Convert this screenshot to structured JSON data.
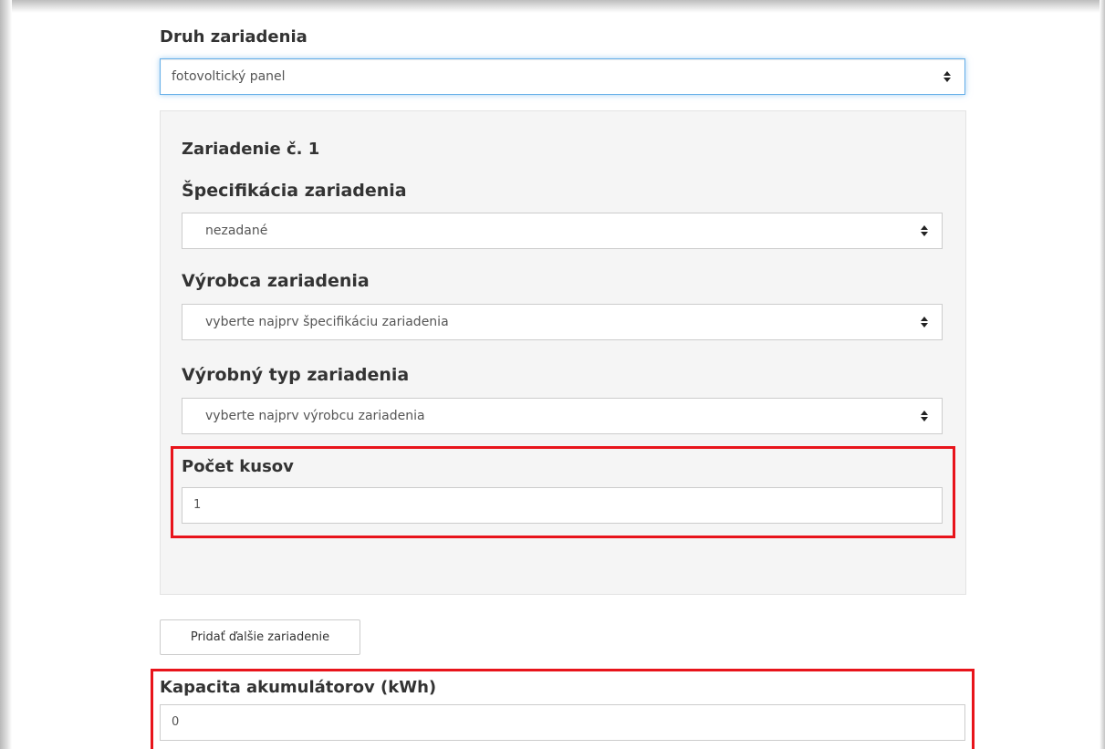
{
  "device_type": {
    "label": "Druh zariadenia",
    "selected": "fotovoltický panel"
  },
  "device_panel": {
    "heading": "Zariadenie č. 1",
    "specification": {
      "label": "Špecifikácia zariadenia",
      "selected": "nezadané"
    },
    "manufacturer": {
      "label": "Výrobca zariadenia",
      "selected": "vyberte najprv špecifikáciu zariadenia"
    },
    "model": {
      "label": "Výrobný typ zariadenia",
      "selected": "vyberte najprv výrobcu zariadenia"
    },
    "quantity": {
      "label": "Počet kusov",
      "value": "1"
    }
  },
  "add_device_button": "Pridať ďalšie zariadenie",
  "battery_capacity": {
    "label": "Kapacita akumulátorov (kWh)",
    "value": "0"
  },
  "colors": {
    "highlight": "#e8141b",
    "focus": "#66afe9",
    "panel_bg": "#f5f5f5"
  }
}
